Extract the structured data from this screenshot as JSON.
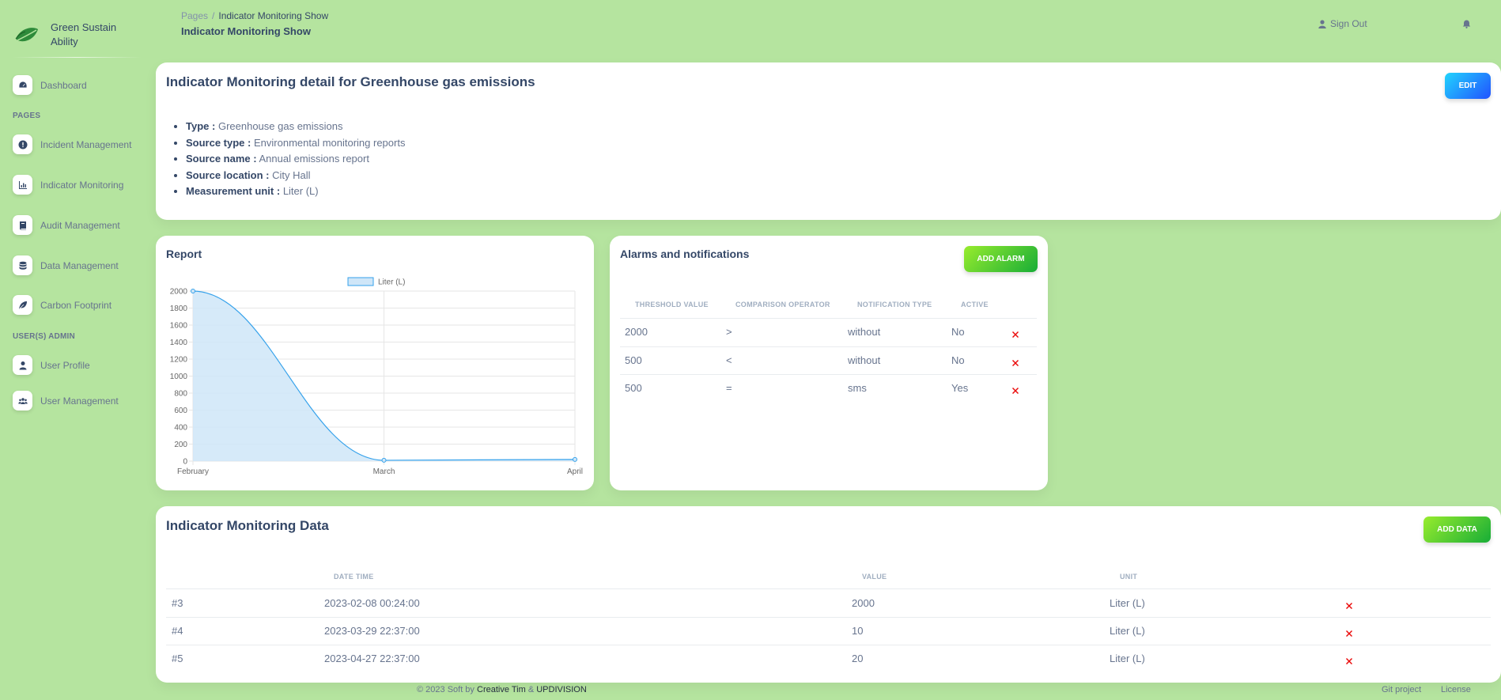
{
  "sidebar": {
    "brand": "Green Sustain Ability",
    "items": [
      {
        "label": "Dashboard",
        "icon": "dashboard-icon"
      },
      {
        "label": "Incident Management",
        "icon": "alert-circle-icon"
      },
      {
        "label": "Indicator Monitoring",
        "icon": "chart-bar-icon"
      },
      {
        "label": "Audit Management",
        "icon": "book-icon"
      },
      {
        "label": "Data Management",
        "icon": "database-icon"
      },
      {
        "label": "Carbon Footprint",
        "icon": "leaf-icon"
      },
      {
        "label": "User Profile",
        "icon": "user-icon"
      },
      {
        "label": "User Management",
        "icon": "users-icon"
      }
    ],
    "headings": {
      "pages": "PAGES",
      "admin": "USER(S) ADMIN"
    }
  },
  "header": {
    "breadcrumb_root": "Pages",
    "breadcrumb_sep": "/",
    "breadcrumb_current": "Indicator Monitoring Show",
    "title": "Indicator Monitoring Show",
    "sign_out": "Sign Out"
  },
  "detail": {
    "title": "Indicator Monitoring detail for Greenhouse gas emissions",
    "edit_label": "EDIT",
    "fields": [
      {
        "label": "Type :",
        "value": "Greenhouse gas emissions"
      },
      {
        "label": "Source type :",
        "value": "Environmental monitoring reports"
      },
      {
        "label": "Source name :",
        "value": "Annual emissions report"
      },
      {
        "label": "Source location :",
        "value": "City Hall"
      },
      {
        "label": "Measurement unit :",
        "value": "Liter (L)"
      }
    ]
  },
  "report": {
    "title": "Report",
    "chart_data": {
      "type": "area",
      "categories": [
        "February",
        "March",
        "April"
      ],
      "series": [
        {
          "name": "Liter (L)",
          "values": [
            2000,
            10,
            20
          ]
        }
      ],
      "ylim": [
        0,
        2000
      ],
      "yticks": [
        "0",
        "200",
        "400",
        "600",
        "800",
        "1000",
        "1200",
        "1400",
        "1600",
        "1800",
        "2000"
      ],
      "legend": "top",
      "grid": true,
      "line_color": "#36a2eb",
      "fill_color": "#cfe6f8"
    }
  },
  "alarms": {
    "title": "Alarms and notifications",
    "add_label": "ADD ALARM",
    "columns": [
      "THRESHOLD VALUE",
      "COMPARISON OPERATOR",
      "NOTIFICATION TYPE",
      "ACTIVE"
    ],
    "rows": [
      {
        "threshold": "2000",
        "operator": ">",
        "type": "without",
        "active": "No"
      },
      {
        "threshold": "500",
        "operator": "<",
        "type": "without",
        "active": "No"
      },
      {
        "threshold": "500",
        "operator": "=",
        "type": "sms",
        "active": "Yes"
      }
    ]
  },
  "data": {
    "title": "Indicator Monitoring Data",
    "add_label": "ADD DATA",
    "columns": [
      "DATE TIME",
      "VALUE",
      "UNIT"
    ],
    "rows": [
      {
        "id": "#3",
        "datetime": "2023-02-08 00:24:00",
        "value": "2000",
        "unit": "Liter (L)"
      },
      {
        "id": "#4",
        "datetime": "2023-03-29 22:37:00",
        "value": "10",
        "unit": "Liter (L)"
      },
      {
        "id": "#5",
        "datetime": "2023-04-27 22:37:00",
        "value": "20",
        "unit": "Liter (L)"
      }
    ]
  },
  "footer": {
    "prefix": "© 2023 Soft by",
    "author1": "Creative Tim",
    "amp": "&",
    "author2": "UPDIVISION",
    "git": "Git project",
    "license": "License"
  },
  "colors": {
    "background": "#b5e49f",
    "accent_blue": "#2152ff",
    "accent_green": "#17ad37",
    "danger": "#ea0606"
  }
}
